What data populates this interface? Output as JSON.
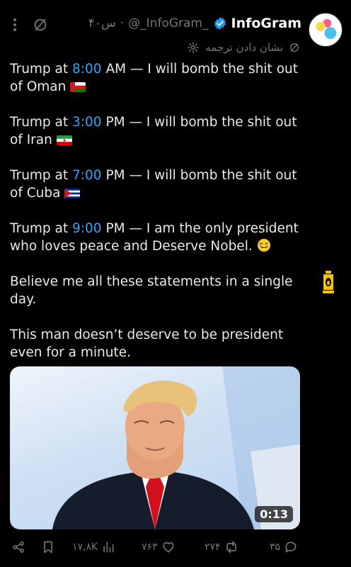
{
  "header": {
    "display_name": "InfoGram",
    "handle": "@_InfoGram_",
    "separator": "·",
    "time": "۴۰س",
    "translate_label": "نشان دادن ترجمه"
  },
  "tweet": {
    "lines": [
      {
        "prefix": "Trump at ",
        "time": "8:00",
        "rest_line1": " AM — I will bomb the shit out",
        "rest_line2": "of Oman"
      },
      {
        "prefix": "Trump at ",
        "time": "3:00",
        "rest_line1": " PM — I will bomb the shit out",
        "rest_line2": "of Iran"
      },
      {
        "prefix": "Trump at ",
        "time": "7:00",
        "rest_line1": " PM — I will bomb the shit out",
        "rest_line2": "of Cuba"
      },
      {
        "prefix": "Trump at ",
        "time": "9:00",
        "rest_line1": " PM — I am the only president",
        "rest_line2": "who loves peace and Deserve Nobel."
      }
    ],
    "believe_line1": "Believe me all these statements in a single",
    "believe_line2": "day.",
    "deserve_line1": "This man doesn’t deserve to be president",
    "deserve_line2": "even for a minute."
  },
  "media": {
    "duration": "0:13"
  },
  "actions": {
    "views": "۱۷,۸K",
    "likes": "۷۶۳",
    "retweets": "۲۷۴",
    "replies": "۳۵"
  },
  "colors": {
    "background": "#000000",
    "text": "#e7e9ea",
    "muted": "#71767b",
    "link_blue": "#3aa0f0",
    "verified_blue": "#1d9bf0"
  }
}
